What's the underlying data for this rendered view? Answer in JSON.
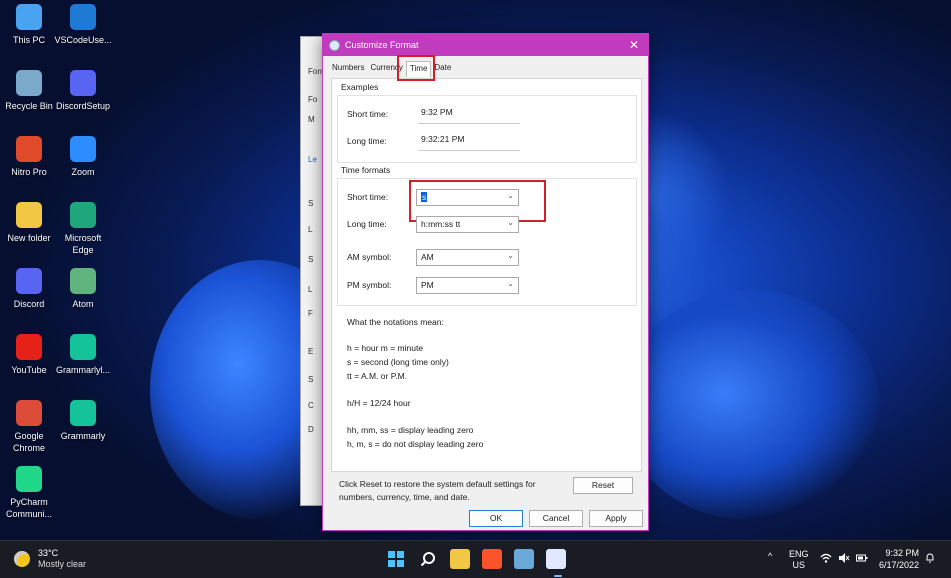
{
  "desktop_icons": [
    {
      "label": "This PC",
      "icon": "monitor-icon",
      "color": "#4aa3f0"
    },
    {
      "label": "VSCodeUse...",
      "icon": "vscode-icon",
      "color": "#1f7ad6"
    },
    {
      "label": "Recycle Bin",
      "icon": "recycle-bin-icon",
      "color": "#7aa9c9"
    },
    {
      "label": "DiscordSetup",
      "icon": "discord-icon",
      "color": "#5865f2"
    },
    {
      "label": "Nitro Pro",
      "icon": "nitro-icon",
      "color": "#e04a2a"
    },
    {
      "label": "Zoom",
      "icon": "zoom-icon",
      "color": "#2d8cff"
    },
    {
      "label": "New folder",
      "icon": "folder-icon",
      "color": "#f2c744"
    },
    {
      "label": "Microsoft Edge",
      "icon": "edge-icon",
      "color": "#1fa67a"
    },
    {
      "label": "Discord",
      "icon": "discord-icon",
      "color": "#5865f2"
    },
    {
      "label": "Atom",
      "icon": "atom-icon",
      "color": "#5fb57d"
    },
    {
      "label": "YouTube",
      "icon": "youtube-icon",
      "color": "#e62117"
    },
    {
      "label": "Grammarlyl...",
      "icon": "grammarly-icon",
      "color": "#15c39a"
    },
    {
      "label": "Google Chrome",
      "icon": "chrome-icon",
      "color": "#dd4b39"
    },
    {
      "label": "Grammarly",
      "icon": "grammarly-icon",
      "color": "#15c39a"
    },
    {
      "label": "PyCharm Communi...",
      "icon": "pycharm-icon",
      "color": "#21d789"
    }
  ],
  "background_window": {
    "fragments": [
      "Form",
      "Fo",
      "M",
      "Le",
      "S",
      "L",
      "S",
      "L",
      "F",
      "E",
      "S",
      "C",
      "D"
    ]
  },
  "dialog": {
    "title": "Customize Format",
    "close_glyph": "✕",
    "tabs": [
      "Numbers",
      "Currency",
      "Time",
      "Date"
    ],
    "active_tab": "Time",
    "examples": {
      "heading": "Examples",
      "short_label": "Short time:",
      "short_value": "9:32 PM",
      "long_label": "Long time:",
      "long_value": "9:32:21 PM"
    },
    "time_formats": {
      "heading": "Time formats",
      "short_label": "Short time:",
      "short_value": "s",
      "long_label": "Long time:",
      "long_value": "h:mm:ss tt",
      "am_label": "AM symbol:",
      "am_value": "AM",
      "pm_label": "PM symbol:",
      "pm_value": "PM",
      "chevron": "⌄"
    },
    "notations": {
      "heading": "What the notations mean:",
      "line1": "h = hour   m = minute",
      "line2": "s = second (long time only)",
      "line3": "tt = A.M. or P.M.",
      "line4": "h/H = 12/24 hour",
      "line5": "hh, mm, ss = display leading zero",
      "line6": "h, m, s = do not display leading zero"
    },
    "reset_text": "Click Reset to restore the system default settings for numbers, currency, time, and date.",
    "reset_label": "Reset",
    "ok_label": "OK",
    "cancel_label": "Cancel",
    "apply_label": "Apply"
  },
  "taskbar": {
    "weather_temp": "33°C",
    "weather_desc": "Mostly clear",
    "tray_chevron": "^",
    "lang_line1": "ENG",
    "lang_line2": "US",
    "time": "9:32 PM",
    "date": "6/17/2022"
  },
  "colors": {
    "accent": "#c03bbd",
    "highlight": "#d2202a",
    "selection": "#0a64d6"
  }
}
